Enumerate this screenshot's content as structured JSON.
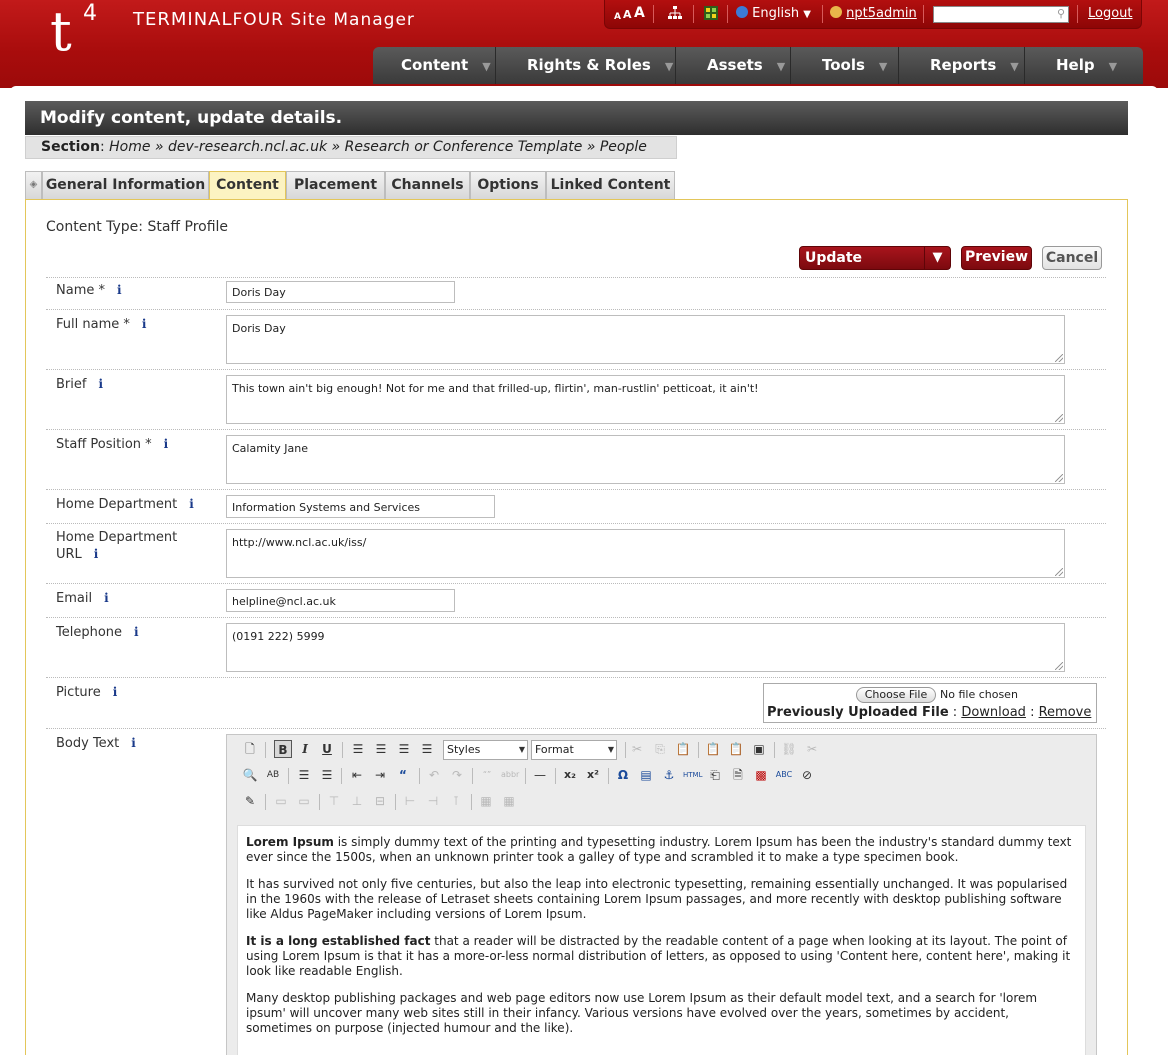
{
  "app": {
    "logo": "t",
    "logo_sup": "4",
    "title_bold": "TERMINAL",
    "title_rest": "FOUR Site Manager"
  },
  "topbar": {
    "text_size_small": "A",
    "text_size_medium": "A",
    "text_size_large": "A",
    "language": "English",
    "username": "npt5admin",
    "search_value": "",
    "logout": "Logout"
  },
  "nav": [
    "Content",
    "Rights & Roles",
    "Assets",
    "Tools",
    "Reports",
    "Help"
  ],
  "page_title": "Modify content, update details.",
  "breadcrumb": {
    "label": "Section",
    "path": "Home » dev-research.ncl.ac.uk » Research or Conference Template » People"
  },
  "tabs": [
    "General Information",
    "Content",
    "Placement",
    "Channels",
    "Options",
    "Linked Content"
  ],
  "active_tab": "Content",
  "content_type": "Content Type: Staff Profile",
  "actions": {
    "update": "Update",
    "preview": "Preview",
    "cancel": "Cancel"
  },
  "fields": {
    "name": {
      "label": "Name *",
      "value": "Doris Day"
    },
    "full_name": {
      "label": "Full name *",
      "value": "Doris Day"
    },
    "brief": {
      "label": "Brief",
      "value": "This town ain't big enough! Not for me and that frilled-up, flirtin', man-rustlin' petticoat, it ain't!"
    },
    "staff_position": {
      "label": "Staff Position *",
      "value": "Calamity Jane"
    },
    "home_department": {
      "label": "Home Department",
      "value": "Information Systems and Services"
    },
    "home_department_url": {
      "label_line1": "Home Department",
      "label_line2": "URL",
      "value": "http://www.ncl.ac.uk/iss/"
    },
    "email": {
      "label": "Email",
      "value": "helpline@ncl.ac.uk"
    },
    "telephone": {
      "label": "Telephone",
      "value": "(0191 222) 5999"
    },
    "picture": {
      "label": "Picture",
      "choose_file": "Choose File",
      "no_file": "No file chosen",
      "previously_uploaded": "Previously Uploaded File",
      "download": "Download",
      "remove": "Remove"
    },
    "body_text": {
      "label": "Body Text"
    }
  },
  "info_glyph": "i",
  "editor": {
    "styles_select": "Styles",
    "format_select": "Format",
    "paragraphs": [
      {
        "bold": "Lorem Ipsum",
        "text": " is simply dummy text of the printing and typesetting industry. Lorem Ipsum has been the industry's standard dummy text ever since the 1500s, when an unknown printer took a galley of type and scrambled it to make a type specimen book."
      },
      {
        "bold": "",
        "text": "It has survived not only five centuries, but also the leap into electronic typesetting, remaining essentially unchanged. It was popularised in the 1960s with the release of Letraset sheets containing Lorem Ipsum passages, and more recently with desktop publishing software like Aldus PageMaker including versions of Lorem Ipsum."
      },
      {
        "bold": "It is a long established fact",
        "text": " that a reader will be distracted by the readable content of a page when looking at its layout. The point of using Lorem Ipsum is that it has a more-or-less normal distribution of letters, as opposed to using 'Content here, content here', making it look like readable English."
      },
      {
        "bold": "",
        "text": "Many desktop publishing packages and web page editors now use Lorem Ipsum as their default model text, and a search for 'lorem ipsum' will uncover many web sites still in their infancy. Various versions have evolved over the years, sometimes by accident, sometimes on purpose (injected humour and the like)."
      }
    ]
  },
  "colors": {
    "brand_red": "#a80c0c",
    "active_tab": "#fcf3c2",
    "info_blue": "#1a3a8a"
  }
}
